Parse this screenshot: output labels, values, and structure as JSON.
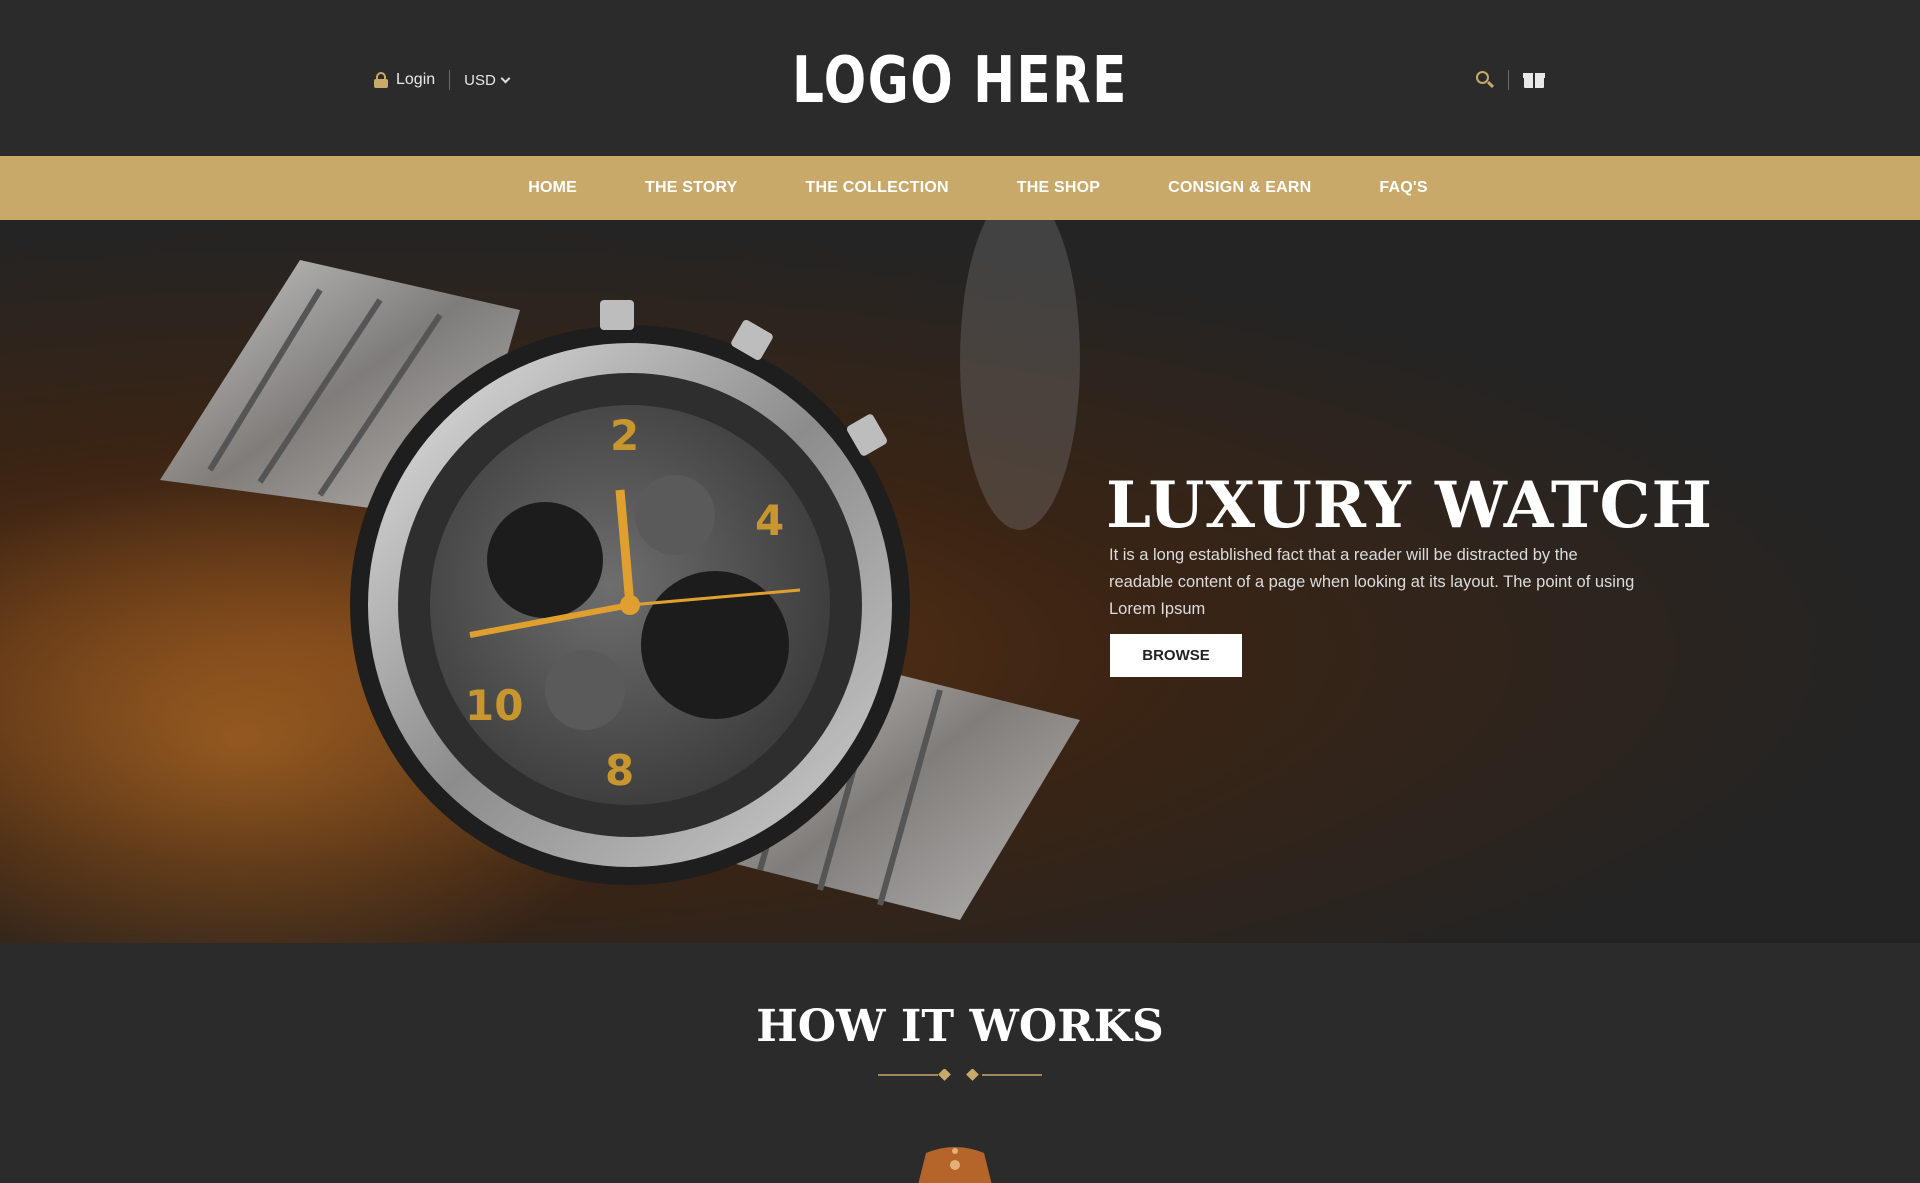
{
  "header": {
    "login_label": "Login",
    "currency": "USD",
    "logo_text": "LOGO HERE",
    "icons": {
      "lock": "lock-icon",
      "search": "search-icon",
      "cart": "box-icon",
      "currency_dropdown": "chevron-down-icon"
    }
  },
  "nav": {
    "items": [
      {
        "label": "HOME"
      },
      {
        "label": "THE STORY"
      },
      {
        "label": "THE COLLECTION"
      },
      {
        "label": "THE SHOP"
      },
      {
        "label": "CONSIGN & EARN"
      },
      {
        "label": "FAQ'S"
      }
    ]
  },
  "hero": {
    "title": "LUXURY WATCH",
    "text": "It is a long established fact that a reader will be distracted by the readable content of a page when looking at its layout. The point of using Lorem Ipsum",
    "button_label": "BROWSE"
  },
  "how_it_works": {
    "title": "HOW IT WORKS"
  },
  "colors": {
    "accent": "#c8a96a",
    "background": "#2b2b2b",
    "text": "#ffffff"
  }
}
